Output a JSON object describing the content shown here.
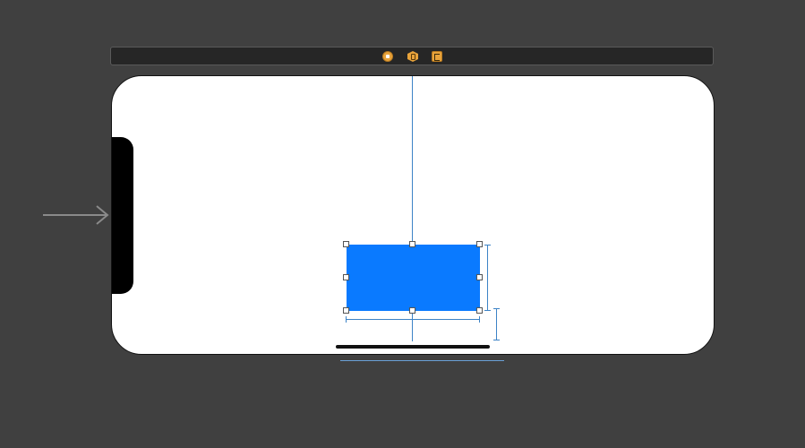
{
  "scene_dock": {
    "icons": [
      "view-controller-icon",
      "first-responder-icon",
      "exit-icon"
    ]
  },
  "colors": {
    "canvas_background": "#404040",
    "scene_background": "#ffffff",
    "view_fill": "#0a7aff",
    "constraint_color": "#3d83c6",
    "dock_icon_color": "#e8a33b"
  },
  "entry_point": {
    "icon": "storyboard-entry-arrow-icon"
  }
}
